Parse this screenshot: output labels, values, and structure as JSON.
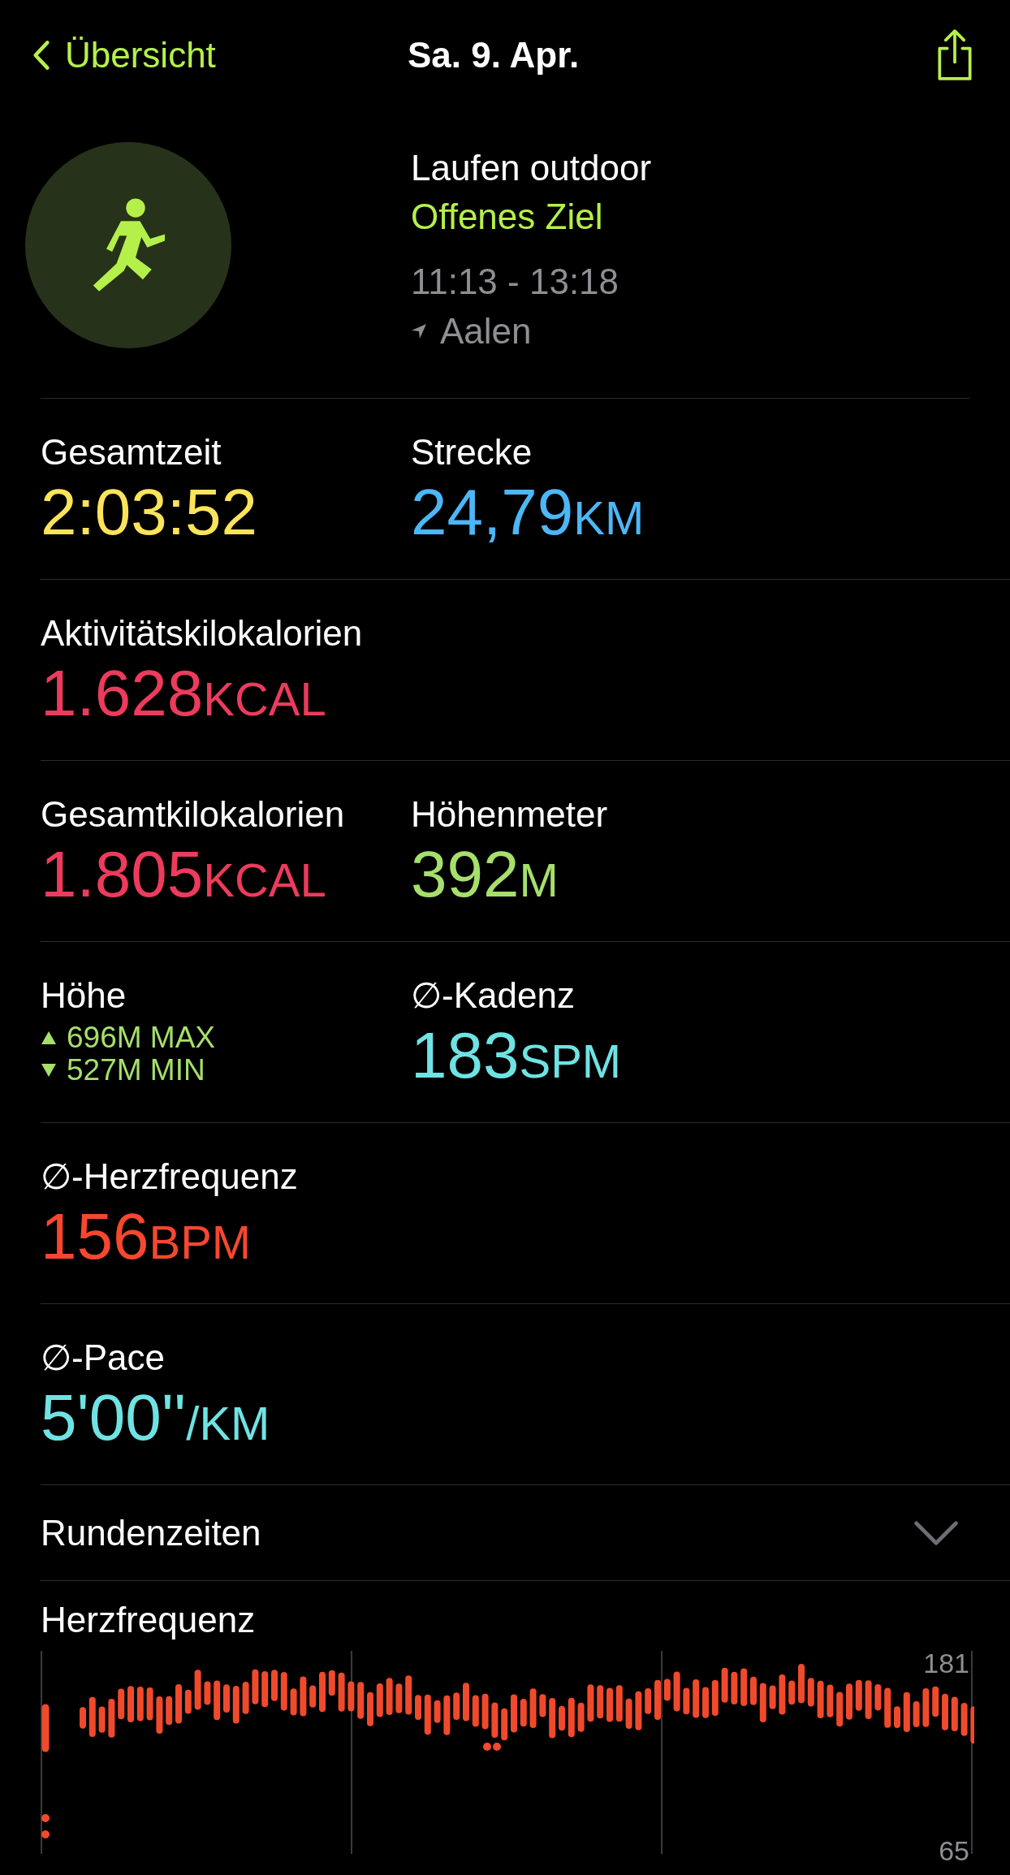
{
  "nav": {
    "back": "Übersicht",
    "title": "Sa. 9. Apr."
  },
  "workout": {
    "name": "Laufen outdoor",
    "goal": "Offenes Ziel",
    "time": "11:13 - 13:18",
    "location": "Aalen"
  },
  "metrics": [
    {
      "cells": [
        {
          "kind": "value",
          "label": "Gesamtzeit",
          "value": "2:03:52",
          "color": "#fce35a"
        },
        {
          "kind": "value",
          "label": "Strecke",
          "value": "24,79",
          "unit": "KM",
          "color": "#4db6f7"
        }
      ]
    },
    {
      "cells": [
        {
          "kind": "value",
          "label": "Aktivitätskilokalorien",
          "value": "1.628",
          "unit": "KCAL",
          "color": "#ec3b5c"
        }
      ]
    },
    {
      "cells": [
        {
          "kind": "value",
          "label": "Gesamtkilokalorien",
          "value": "1.805",
          "unit": "KCAL",
          "color": "#ec3b5c"
        },
        {
          "kind": "value",
          "label": "Höhenmeter",
          "value": "392",
          "unit": "M",
          "color": "#a6df6b"
        }
      ]
    },
    {
      "cells": [
        {
          "kind": "range",
          "label": "Höhe",
          "max": "696M MAX",
          "min": "527M MIN",
          "color": "#a6df6b"
        },
        {
          "kind": "value",
          "label": "∅-Kadenz",
          "value": "183",
          "unit": "SPM",
          "color": "#6fe3e3"
        }
      ]
    },
    {
      "cells": [
        {
          "kind": "value",
          "label": "∅-Herzfrequenz",
          "value": "156",
          "unit": "BPM",
          "color": "#f7472e"
        }
      ]
    },
    {
      "cells": [
        {
          "kind": "value",
          "label": "∅-Pace",
          "value": "5'00''",
          "unit": "/KM",
          "color": "#6fe3e3"
        }
      ]
    }
  ],
  "laps": {
    "label": "Rundenzeiten",
    "expanded": false
  },
  "heart_chart": {
    "title": "Herzfrequenz",
    "y_max": "181",
    "y_min": "65"
  }
}
